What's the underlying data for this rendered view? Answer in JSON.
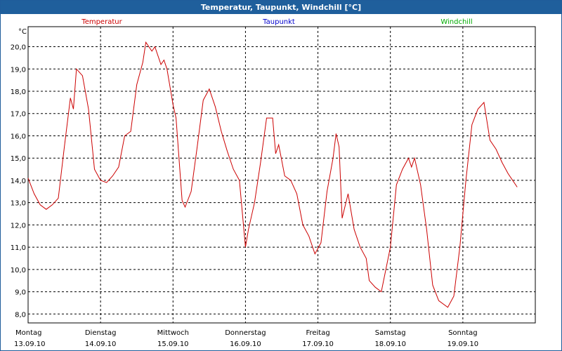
{
  "window": {
    "title": "Temperatur, Taupunkt, Windchill [°C]"
  },
  "colors": {
    "titlebar": "#1f5f9c",
    "temperature": "#cc0000",
    "dewpoint": "#0000cc",
    "windchill": "#00aa00",
    "grid": "#000000"
  },
  "chart_data": {
    "type": "line",
    "title": "Temperatur, Taupunkt, Windchill [°C]",
    "ylabel": "°C",
    "xlabel": "",
    "ylim": [
      7.6,
      20.9
    ],
    "xlim": [
      "2010-09-13 00:00",
      "2010-09-20 00:00"
    ],
    "grid": true,
    "legend_position": "top",
    "legend": [
      "Temperatur",
      "Taupunkt",
      "Windchill"
    ],
    "y_ticks": [
      "8,0",
      "9,0",
      "10,0",
      "11,0",
      "12,0",
      "13,0",
      "14,0",
      "15,0",
      "16,0",
      "17,0",
      "18,0",
      "19,0",
      "20,0"
    ],
    "x_ticks": [
      {
        "day": "Montag",
        "date": "13.09.10"
      },
      {
        "day": "Dienstag",
        "date": "14.09.10"
      },
      {
        "day": "Mittwoch",
        "date": "15.09.10"
      },
      {
        "day": "Donnerstag",
        "date": "16.09.10"
      },
      {
        "day": "Freitag",
        "date": "17.09.10"
      },
      {
        "day": "Samstag",
        "date": "18.09.10"
      },
      {
        "day": "Sonntag",
        "date": "19.09.10"
      }
    ],
    "series": [
      {
        "name": "Temperatur",
        "points": [
          [
            "2010-09-13 00:00",
            14.1
          ],
          [
            "2010-09-13 02:00",
            13.4
          ],
          [
            "2010-09-13 04:00",
            12.9
          ],
          [
            "2010-09-13 06:00",
            12.7
          ],
          [
            "2010-09-13 08:00",
            12.9
          ],
          [
            "2010-09-13 10:00",
            13.2
          ],
          [
            "2010-09-13 12:00",
            15.5
          ],
          [
            "2010-09-13 14:00",
            17.7
          ],
          [
            "2010-09-13 15:00",
            17.2
          ],
          [
            "2010-09-13 16:00",
            19.0
          ],
          [
            "2010-09-13 18:00",
            18.7
          ],
          [
            "2010-09-13 20:00",
            17.2
          ],
          [
            "2010-09-13 22:00",
            14.5
          ],
          [
            "2010-09-14 00:00",
            14.0
          ],
          [
            "2010-09-14 02:00",
            13.9
          ],
          [
            "2010-09-14 04:00",
            14.2
          ],
          [
            "2010-09-14 06:00",
            14.6
          ],
          [
            "2010-09-14 08:00",
            16.0
          ],
          [
            "2010-09-14 10:00",
            16.2
          ],
          [
            "2010-09-14 12:00",
            18.3
          ],
          [
            "2010-09-14 14:00",
            19.3
          ],
          [
            "2010-09-14 15:00",
            20.2
          ],
          [
            "2010-09-14 17:00",
            19.8
          ],
          [
            "2010-09-14 18:00",
            20.0
          ],
          [
            "2010-09-14 20:00",
            19.2
          ],
          [
            "2010-09-14 21:00",
            19.4
          ],
          [
            "2010-09-14 22:00",
            19.0
          ],
          [
            "2010-09-15 00:00",
            17.4
          ],
          [
            "2010-09-15 01:00",
            16.8
          ],
          [
            "2010-09-15 03:00",
            13.1
          ],
          [
            "2010-09-15 04:00",
            12.8
          ],
          [
            "2010-09-15 06:00",
            13.5
          ],
          [
            "2010-09-15 08:00",
            15.5
          ],
          [
            "2010-09-15 10:00",
            17.6
          ],
          [
            "2010-09-15 12:00",
            18.1
          ],
          [
            "2010-09-15 14:00",
            17.3
          ],
          [
            "2010-09-15 16:00",
            16.2
          ],
          [
            "2010-09-15 18:00",
            15.3
          ],
          [
            "2010-09-15 20:00",
            14.5
          ],
          [
            "2010-09-15 22:00",
            14.0
          ],
          [
            "2010-09-16 00:00",
            11.0
          ],
          [
            "2010-09-16 01:00",
            11.8
          ],
          [
            "2010-09-16 03:00",
            13.0
          ],
          [
            "2010-09-16 05:00",
            14.8
          ],
          [
            "2010-09-16 07:00",
            16.8
          ],
          [
            "2010-09-16 09:00",
            16.8
          ],
          [
            "2010-09-16 10:00",
            15.2
          ],
          [
            "2010-09-16 11:00",
            15.6
          ],
          [
            "2010-09-16 13:00",
            14.2
          ],
          [
            "2010-09-16 15:00",
            14.0
          ],
          [
            "2010-09-16 17:00",
            13.4
          ],
          [
            "2010-09-16 19:00",
            12.0
          ],
          [
            "2010-09-16 21:00",
            11.5
          ],
          [
            "2010-09-16 23:00",
            10.7
          ],
          [
            "2010-09-17 01:00",
            11.2
          ],
          [
            "2010-09-17 03:00",
            13.5
          ],
          [
            "2010-09-17 05:00",
            15.0
          ],
          [
            "2010-09-17 06:00",
            16.1
          ],
          [
            "2010-09-17 07:00",
            15.5
          ],
          [
            "2010-09-17 08:00",
            12.3
          ],
          [
            "2010-09-17 10:00",
            13.4
          ],
          [
            "2010-09-17 12:00",
            11.8
          ],
          [
            "2010-09-17 14:00",
            11.0
          ],
          [
            "2010-09-17 16:00",
            10.5
          ],
          [
            "2010-09-17 17:00",
            9.5
          ],
          [
            "2010-09-17 19:00",
            9.2
          ],
          [
            "2010-09-17 21:00",
            9.0
          ],
          [
            "2010-09-18 00:00",
            11.0
          ],
          [
            "2010-09-18 02:00",
            13.8
          ],
          [
            "2010-09-18 04:00",
            14.5
          ],
          [
            "2010-09-18 06:00",
            15.0
          ],
          [
            "2010-09-18 07:00",
            14.6
          ],
          [
            "2010-09-18 08:00",
            15.0
          ],
          [
            "2010-09-18 10:00",
            13.8
          ],
          [
            "2010-09-18 12:00",
            11.8
          ],
          [
            "2010-09-18 14:00",
            9.3
          ],
          [
            "2010-09-18 16:00",
            8.6
          ],
          [
            "2010-09-18 19:00",
            8.3
          ],
          [
            "2010-09-18 21:00",
            8.8
          ],
          [
            "2010-09-18 23:00",
            11.0
          ],
          [
            "2010-09-19 01:00",
            14.0
          ],
          [
            "2010-09-19 03:00",
            16.5
          ],
          [
            "2010-09-19 05:00",
            17.2
          ],
          [
            "2010-09-19 07:00",
            17.5
          ],
          [
            "2010-09-19 09:00",
            15.8
          ],
          [
            "2010-09-19 11:00",
            15.4
          ],
          [
            "2010-09-19 13:00",
            14.8
          ],
          [
            "2010-09-19 15:00",
            14.3
          ],
          [
            "2010-09-19 18:00",
            13.7
          ]
        ]
      }
    ]
  }
}
